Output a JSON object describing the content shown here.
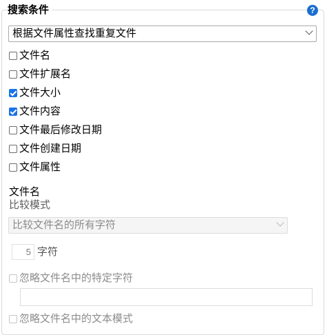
{
  "group": {
    "title": "搜索条件",
    "help_icon_glyph": "?"
  },
  "mode_select": {
    "value": "根据文件属性查找重复文件"
  },
  "criteria": [
    {
      "label": "文件名",
      "checked": false
    },
    {
      "label": "文件扩展名",
      "checked": false
    },
    {
      "label": "文件大小",
      "checked": true
    },
    {
      "label": "文件内容",
      "checked": true
    },
    {
      "label": "文件最后修改日期",
      "checked": false
    },
    {
      "label": "文件创建日期",
      "checked": false
    },
    {
      "label": "文件属性",
      "checked": false
    }
  ],
  "filename_section": {
    "title": "文件名",
    "compare_mode_label": "比较模式",
    "compare_mode_value": "比较文件名的所有字符",
    "char_count_value": "5",
    "char_count_unit": "字符",
    "ignore_specific_chars_label": "忽略文件名中的特定字符",
    "ignore_specific_chars_value": "",
    "ignore_text_pattern_label": "忽略文件名中的文本模式"
  },
  "colors": {
    "accent": "#1a73e8",
    "help_icon": "#1a6fd0"
  }
}
